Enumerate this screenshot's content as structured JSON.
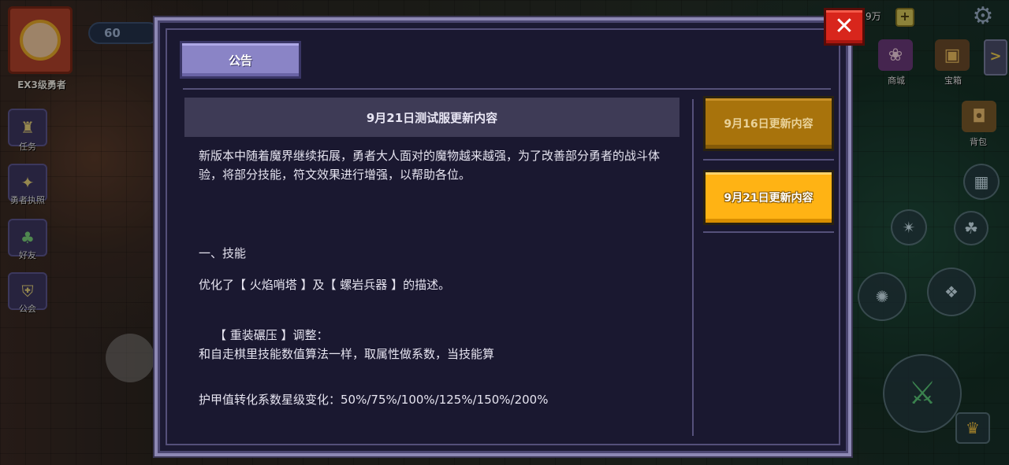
{
  "hud": {
    "rank_label": "EX3级勇者",
    "level": "60",
    "left_menu": [
      {
        "label": "任务",
        "icon": "trophy-icon"
      },
      {
        "label": "勇者执照",
        "icon": "license-badge-icon"
      },
      {
        "label": "好友",
        "icon": "mushroom-icon"
      },
      {
        "label": "公会",
        "icon": "guild-shield-icon"
      }
    ],
    "currency": "9万",
    "plus_symbol": "+",
    "right_menu": [
      {
        "label": "商城",
        "icon": "shop-icon"
      },
      {
        "label": "宝箱",
        "icon": "chest-icon"
      },
      {
        "label": "背包",
        "icon": "backpack-icon"
      }
    ],
    "arrow_symbol": ">"
  },
  "modal": {
    "title": "公告",
    "close_symbol": "✕",
    "content": {
      "header": "9月21日测试服更新内容",
      "paragraphs": [
        "新版本中随着魔界继续拓展，勇者大人面对的魔物越来越强，为了改善部分勇者的战斗体验，将部分技能，符文效果进行增强，以帮助各位。",
        "一、技能",
        "优化了【 火焰哨塔 】及【 螺岩兵器 】的描述。",
        "【 重装碾压 】调整：",
        "和自走棋里技能数值算法一样，取属性做系数，当技能算",
        "护甲值转化系数星级变化：50%/75%/100%/125%/150%/200%"
      ]
    },
    "tabs": [
      {
        "label": "9月16日更新内容",
        "active": false
      },
      {
        "label": "9月21日更新内容",
        "active": true
      }
    ]
  },
  "colors": {
    "accent_active_tab": "#ffb314",
    "inactive_tab": "#a8730c",
    "close_button": "#d8261c",
    "title_button": "#8a84c6",
    "modal_bg": "#1c1a33"
  }
}
